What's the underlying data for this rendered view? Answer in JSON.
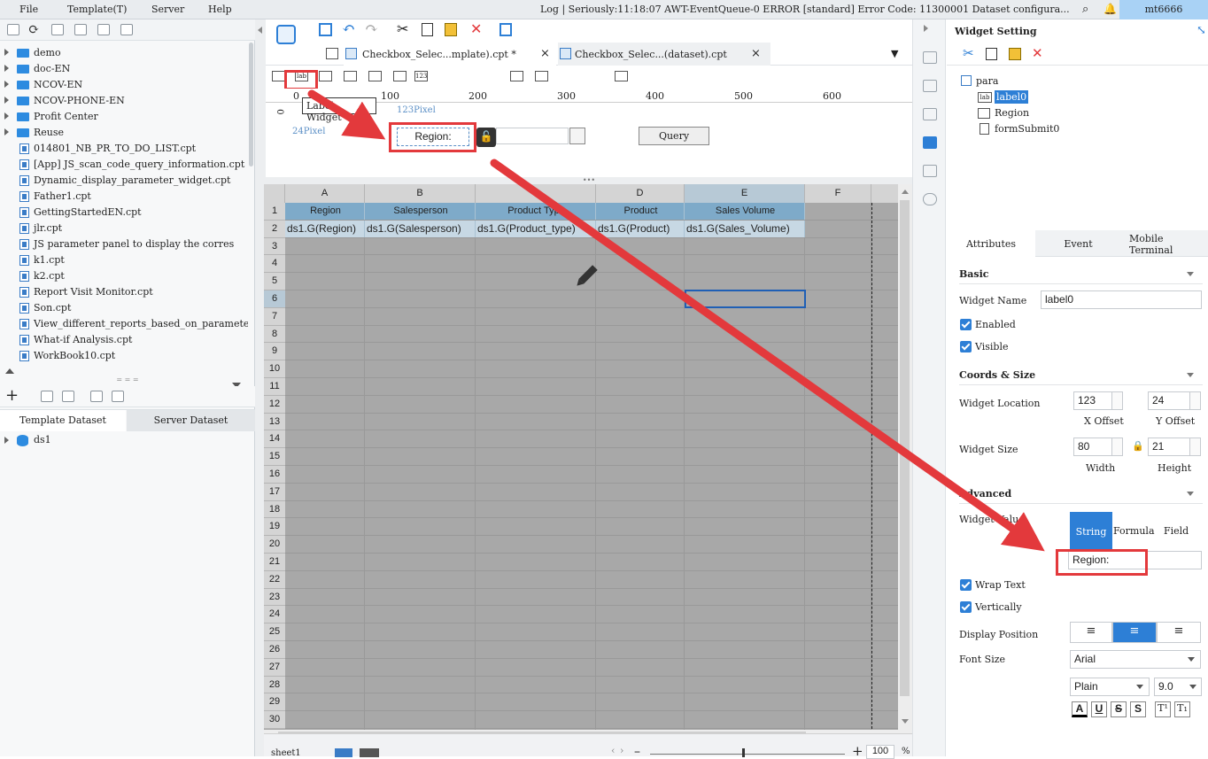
{
  "menu": {
    "items": [
      "File",
      "Template(T)",
      "Server",
      "Help"
    ]
  },
  "status": {
    "log": "Log | Seriously:11:18:07 AWT-EventQueue-0 ERROR [standard] Error Code: 11300001 Dataset configura...",
    "user": "mt6666"
  },
  "file_tree": [
    {
      "label": "demo",
      "type": "folder"
    },
    {
      "label": "doc-EN",
      "type": "folder"
    },
    {
      "label": "NCOV-EN",
      "type": "folder"
    },
    {
      "label": "NCOV-PHONE-EN",
      "type": "folder"
    },
    {
      "label": "Profit Center",
      "type": "folder"
    },
    {
      "label": "Reuse",
      "type": "folder"
    },
    {
      "label": "014801_NB_PR_TO_DO_LIST.cpt",
      "type": "file"
    },
    {
      "label": "[App] JS_scan_code_query_information.cpt",
      "type": "file"
    },
    {
      "label": "Dynamic_display_parameter_widget.cpt",
      "type": "file"
    },
    {
      "label": "Father1.cpt",
      "type": "file"
    },
    {
      "label": "GettingStartedEN.cpt",
      "type": "file"
    },
    {
      "label": "jlr.cpt",
      "type": "file"
    },
    {
      "label": "JS parameter panel to display the corres",
      "type": "file"
    },
    {
      "label": "k1.cpt",
      "type": "file"
    },
    {
      "label": "k2.cpt",
      "type": "file"
    },
    {
      "label": "Report Visit Monitor.cpt",
      "type": "file"
    },
    {
      "label": "Son.cpt",
      "type": "file"
    },
    {
      "label": "View_different_reports_based_on_paramete",
      "type": "file"
    },
    {
      "label": "What-if Analysis.cpt",
      "type": "file"
    },
    {
      "label": "WorkBook10.cpt",
      "type": "file"
    }
  ],
  "dataset_tabs": {
    "template": "Template Dataset",
    "server": "Server Dataset"
  },
  "datasets": [
    "ds1"
  ],
  "doc_tabs": [
    "Checkbox_Selec...mplate).cpt *",
    "Checkbox_Selec...(dataset).cpt"
  ],
  "ruler": {
    "ticks": [
      "0",
      "100",
      "200",
      "300",
      "400",
      "500",
      "600"
    ]
  },
  "param_panel": {
    "label_widget_tooltip": "Label Widget",
    "x_hint": "123Pixel",
    "y_hint": "24Pixel",
    "label_text": "Region:",
    "query_button": "Query"
  },
  "sheet": {
    "columns": [
      "A",
      "B",
      "C",
      "D",
      "E",
      "F"
    ],
    "rows": [
      "1",
      "2",
      "3",
      "4",
      "5",
      "6",
      "7",
      "8",
      "9",
      "10",
      "11",
      "12",
      "13",
      "14",
      "15",
      "16",
      "17",
      "18",
      "19",
      "20",
      "21",
      "22",
      "23",
      "24",
      "25",
      "26",
      "27",
      "28",
      "29",
      "30"
    ],
    "header_row": [
      "Region",
      "Salesperson",
      "Product Type",
      "Product",
      "Sales Volume"
    ],
    "data_row": [
      "ds1.G(Region)",
      "ds1.G(Salesperson)",
      "ds1.G(Product_type)",
      "ds1.G(Product)",
      "ds1.G(Sales_Volume)"
    ],
    "sheet_name": "sheet1",
    "zoom": "100",
    "zoom_unit": "%"
  },
  "widget_setting": {
    "title": "Widget Setting",
    "tree": {
      "root": "para",
      "children": [
        "label0",
        "Region",
        "formSubmit0"
      ]
    },
    "tabs": [
      "Attributes",
      "Event",
      "Mobile Terminal"
    ],
    "sections": {
      "basic": "Basic",
      "coords": "Coords & Size",
      "advanced": "Advanced"
    },
    "widget_name_label": "Widget Name",
    "widget_name": "label0",
    "enabled": "Enabled",
    "visible": "Visible",
    "location_label": "Widget Location",
    "x_offset": "123",
    "y_offset": "24",
    "x_offset_label": "X Offset",
    "y_offset_label": "Y Offset",
    "size_label": "Widget Size",
    "width": "80",
    "height": "21",
    "width_label": "Width",
    "height_label": "Height",
    "widget_value_label": "Widget Value",
    "value_types": [
      "String",
      "Formula",
      "Field"
    ],
    "widget_value": "Region:",
    "wrap_text": "Wrap Text",
    "vertically": "Vertically",
    "display_position_label": "Display Position",
    "font_size_label": "Font Size",
    "font_family": "Arial",
    "font_style": "Plain",
    "font_size": "9.0",
    "text_effects": [
      "A",
      "U",
      "S",
      "S",
      "T¹",
      "T₁"
    ]
  },
  "colors": {
    "accent": "#2d7fd6",
    "annotation": "#e3393c",
    "header_cell": "#7eaac9",
    "data_cell": "#c7d8e4"
  }
}
